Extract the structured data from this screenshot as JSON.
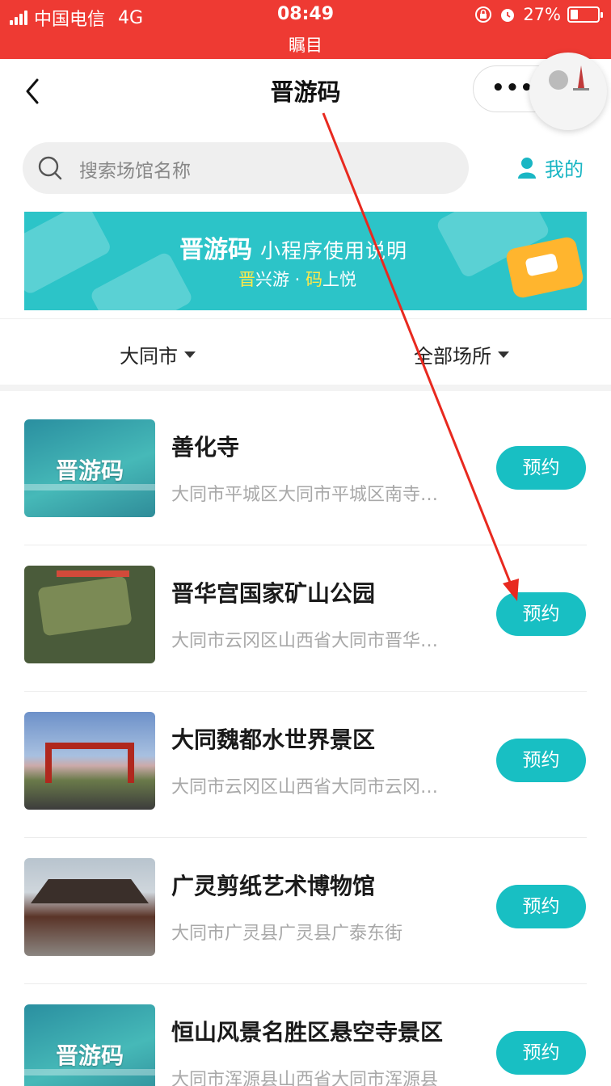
{
  "status_bar": {
    "carrier": "中国电信",
    "network": "4G",
    "time": "08:49",
    "subtitle": "瞩目",
    "battery": "27%",
    "battery_level": 0.27
  },
  "nav": {
    "title": "晋游码",
    "more_label": "•••"
  },
  "search": {
    "placeholder": "搜索场馆名称",
    "mine_label": "我的"
  },
  "banner": {
    "brand": "晋游码",
    "title": "小程序使用说明",
    "slogan_a": "晋",
    "slogan_b": "兴游 · ",
    "slogan_c": "码",
    "slogan_d": "上悦"
  },
  "filters": {
    "city": "大同市",
    "venue_type": "全部场所"
  },
  "venues": [
    {
      "name": "善化寺",
      "address": "大同市平城区大同市平城区南寺…",
      "button": "预约",
      "thumb_text": "晋游码"
    },
    {
      "name": "晋华宫国家矿山公园",
      "address": "大同市云冈区山西省大同市晋华…",
      "button": "预约"
    },
    {
      "name": "大同魏都水世界景区",
      "address": "大同市云冈区山西省大同市云冈…",
      "button": "预约"
    },
    {
      "name": "广灵剪纸艺术博物馆",
      "address": "大同市广灵县广灵县广泰东街",
      "button": "预约"
    },
    {
      "name": "恒山风景名胜区悬空寺景区",
      "address": "大同市浑源县山西省大同市浑源县",
      "button": "预约",
      "thumb_text": "晋游码"
    }
  ],
  "colors": {
    "status_red": "#ee3a33",
    "accent_teal": "#18bfc3",
    "annotation_red": "#e8291f"
  }
}
